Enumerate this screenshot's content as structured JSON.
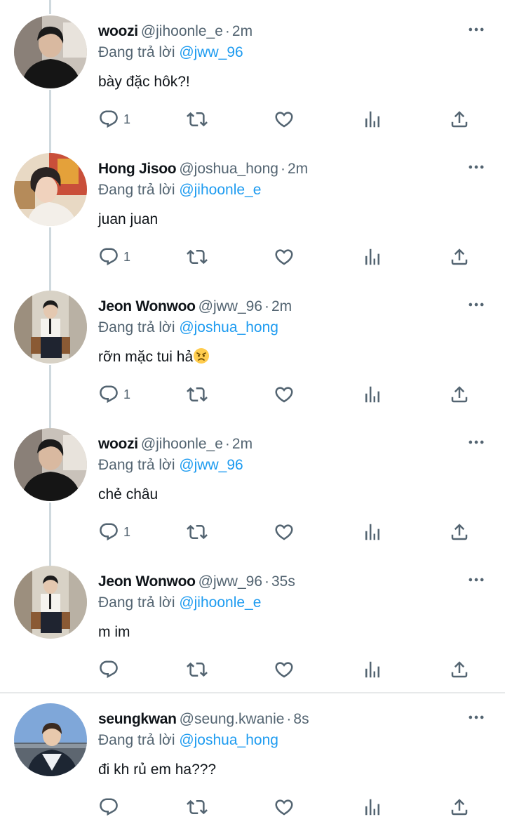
{
  "colors": {
    "accent": "#1d9bf0",
    "secondary_text": "#536471",
    "primary_text": "#0f1419",
    "thread_line": "#cfd9de"
  },
  "tweets": [
    {
      "name": "woozi",
      "handle": "@jihoonle_e",
      "sep": "·",
      "time": "2m",
      "replying_prefix": "Đang trả lời",
      "replying_to": "@jww_96",
      "text": "bày đặc hôk?!",
      "reply_count": "1",
      "avatar": "woozi-avatar"
    },
    {
      "name": "Hong Jisoo",
      "handle": "@joshua_hong",
      "sep": "·",
      "time": "2m",
      "replying_prefix": "Đang trả lời",
      "replying_to": "@jihoonle_e",
      "text": "juan juan",
      "reply_count": "1",
      "avatar": "jisoo-avatar"
    },
    {
      "name": "Jeon Wonwoo",
      "handle": "@jww_96",
      "sep": "·",
      "time": "2m",
      "replying_prefix": "Đang trả lời",
      "replying_to": "@joshua_hong",
      "text": "rỡn mặc tui hả",
      "emoji": "angry-face-emoji",
      "reply_count": "1",
      "avatar": "wonwoo-avatar"
    },
    {
      "name": "woozi",
      "handle": "@jihoonle_e",
      "sep": "·",
      "time": "2m",
      "replying_prefix": "Đang trả lời",
      "replying_to": "@jww_96",
      "text": "chẻ châu",
      "reply_count": "1",
      "avatar": "woozi-avatar"
    },
    {
      "name": "Jeon Wonwoo",
      "handle": "@jww_96",
      "sep": "·",
      "time": "35s",
      "replying_prefix": "Đang trả lời",
      "replying_to": "@jihoonle_e",
      "text": "m im",
      "reply_count": "",
      "avatar": "wonwoo-avatar"
    },
    {
      "name": "seungkwan",
      "handle": "@seung.kwanie",
      "sep": "·",
      "time": "8s",
      "replying_prefix": "Đang trả lời",
      "replying_to": "@joshua_hong",
      "text": "đi kh rủ em ha???",
      "reply_count": "",
      "avatar": "seungkwan-avatar"
    }
  ]
}
